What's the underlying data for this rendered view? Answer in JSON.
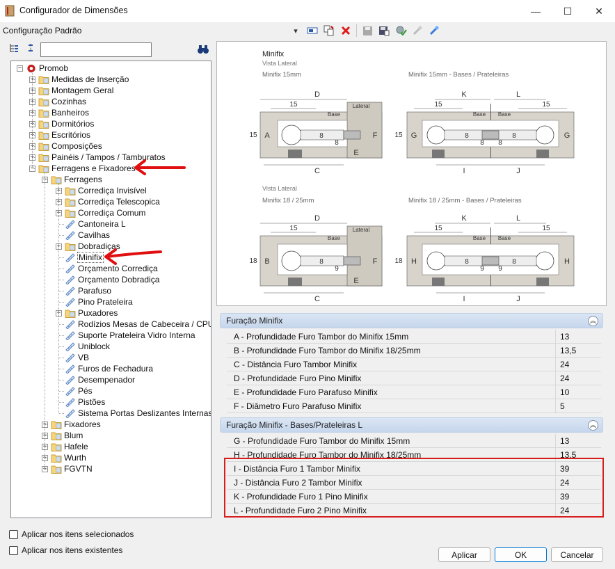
{
  "window": {
    "title": "Configurador de Dimensões",
    "minimize_glyph": "—",
    "maximize_glyph": "☐",
    "close_glyph": "✕"
  },
  "config_label": "Configuração Padrão",
  "search": {
    "value": ""
  },
  "tree": {
    "items": [
      {
        "label": "Promob",
        "level": 0,
        "kind": "root",
        "expanded": true
      },
      {
        "label": "Medidas de Inserção",
        "level": 1,
        "kind": "folder"
      },
      {
        "label": "Montagem Geral",
        "level": 1,
        "kind": "folder"
      },
      {
        "label": "Cozinhas",
        "level": 1,
        "kind": "folder"
      },
      {
        "label": "Banheiros",
        "level": 1,
        "kind": "folder"
      },
      {
        "label": "Dormitórios",
        "level": 1,
        "kind": "folder"
      },
      {
        "label": "Escritórios",
        "level": 1,
        "kind": "folder"
      },
      {
        "label": "Composições",
        "level": 1,
        "kind": "folder"
      },
      {
        "label": "Painéis / Tampos / Tamburatos",
        "level": 1,
        "kind": "folder"
      },
      {
        "label": "Ferragens e Fixadores",
        "level": 1,
        "kind": "folder",
        "expanded": true
      },
      {
        "label": "Ferragens",
        "level": 2,
        "kind": "folder",
        "expanded": true
      },
      {
        "label": "Corrediça Invisível",
        "level": 3,
        "kind": "folder"
      },
      {
        "label": "Corrediça Telescopica",
        "level": 3,
        "kind": "folder"
      },
      {
        "label": "Corrediça Comum",
        "level": 3,
        "kind": "folder"
      },
      {
        "label": "Cantoneira L",
        "level": 3,
        "kind": "leaf"
      },
      {
        "label": "Cavilhas",
        "level": 3,
        "kind": "leaf"
      },
      {
        "label": "Dobradiças",
        "level": 3,
        "kind": "folder"
      },
      {
        "label": "Minifix",
        "level": 3,
        "kind": "leaf",
        "selected": true
      },
      {
        "label": "Orçamento Corrediça",
        "level": 3,
        "kind": "leaf"
      },
      {
        "label": "Orçamento Dobradiça",
        "level": 3,
        "kind": "leaf"
      },
      {
        "label": "Parafuso",
        "level": 3,
        "kind": "leaf"
      },
      {
        "label": "Pino Prateleira",
        "level": 3,
        "kind": "leaf"
      },
      {
        "label": "Puxadores",
        "level": 3,
        "kind": "folder"
      },
      {
        "label": "Rodízios Mesas de Cabeceira / CPU",
        "level": 3,
        "kind": "leaf"
      },
      {
        "label": "Suporte Prateleira Vidro Interna",
        "level": 3,
        "kind": "leaf"
      },
      {
        "label": "Uniblock",
        "level": 3,
        "kind": "leaf"
      },
      {
        "label": "VB",
        "level": 3,
        "kind": "leaf"
      },
      {
        "label": "Furos de Fechadura",
        "level": 3,
        "kind": "leaf"
      },
      {
        "label": "Desempenador",
        "level": 3,
        "kind": "leaf"
      },
      {
        "label": "Pés",
        "level": 3,
        "kind": "leaf"
      },
      {
        "label": "Pistões",
        "level": 3,
        "kind": "leaf"
      },
      {
        "label": "Sistema Portas Deslizantes Internas",
        "level": 3,
        "kind": "leaf"
      },
      {
        "label": "Fixadores",
        "level": 2,
        "kind": "folder"
      },
      {
        "label": "Blum",
        "level": 2,
        "kind": "folder"
      },
      {
        "label": "Hafele",
        "level": 2,
        "kind": "folder"
      },
      {
        "label": "Wurth",
        "level": 2,
        "kind": "folder"
      },
      {
        "label": "FGVTN",
        "level": 2,
        "kind": "folder"
      }
    ]
  },
  "image": {
    "title": "Minifix",
    "subtitle": "Vista Lateral",
    "subtitle2": "Vista Lateral",
    "cap_15": "Minifix 15mm",
    "cap_15_bases": "Minifix 15mm - Bases / Prateleiras",
    "cap_18": "Minifix 18 / 25mm",
    "cap_18_bases": "Minifix 18 / 25mm - Bases / Prateleiras",
    "lateral": "Lateral",
    "base": "Base",
    "dims": {
      "15": "15",
      "18": "18",
      "8": "8",
      "9": "9"
    },
    "letters": {
      "A": "A",
      "B": "B",
      "C": "C",
      "D": "D",
      "E": "E",
      "F": "F",
      "G": "G",
      "H": "H",
      "I": "I",
      "J": "J",
      "K": "K",
      "L": "L"
    }
  },
  "groups": [
    {
      "title": "Furação Minifix",
      "rows": [
        {
          "name": "A - Profundidade Furo Tambor do Minifix 15mm",
          "value": "13"
        },
        {
          "name": "B - Profundidade Furo Tambor do Minifix 18/25mm",
          "value": "13,5"
        },
        {
          "name": "C - Distância Furo Tambor Minifix",
          "value": "24"
        },
        {
          "name": "D - Profundidade Furo Pino Minifix",
          "value": "24"
        },
        {
          "name": "E - Profundidade Furo Parafuso Minifix",
          "value": "10"
        },
        {
          "name": "F - Diâmetro Furo Parafuso Minifix",
          "value": "5"
        }
      ]
    },
    {
      "title": "Furação Minifix - Bases/Prateleiras L",
      "rows": [
        {
          "name": "G - Profundidade Furo Tambor do Minifix 15mm",
          "value": "13"
        },
        {
          "name": "H - Profundidade Furo Tambor do Minifix 18/25mm",
          "value": "13,5"
        },
        {
          "name": "I - Distância Furo 1 Tambor Minifix",
          "value": "39"
        },
        {
          "name": "J - Distância Furo 2 Tambor Minifix",
          "value": "24"
        },
        {
          "name": "K - Profundidade Furo 1 Pino Minifix",
          "value": "39"
        },
        {
          "name": "L - Profundidade Furo 2 Pino Minifix",
          "value": "24"
        }
      ]
    }
  ],
  "options": {
    "apply_selected": "Aplicar nos itens selecionados",
    "apply_existing": "Aplicar nos itens existentes"
  },
  "buttons": {
    "apply": "Aplicar",
    "ok": "OK",
    "cancel": "Cancelar"
  },
  "colors": {
    "annotation_red": "#d81d1d",
    "group_header": "#c6d6ec",
    "drawing_board": "#d8d4cb"
  }
}
